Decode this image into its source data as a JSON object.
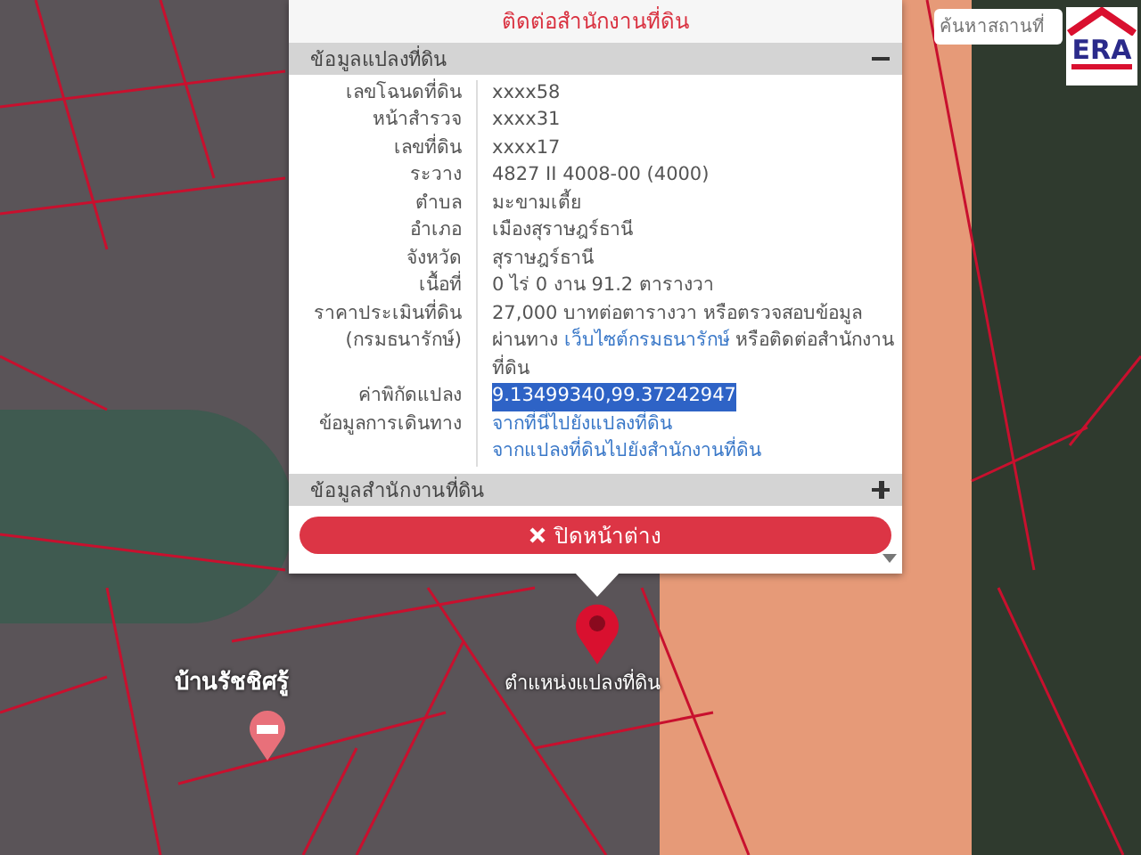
{
  "popup": {
    "contact_link": "ติดต่อสำนักงานที่ดิน",
    "sections": [
      {
        "title": "ข้อมูลแปลงที่ดิน",
        "expanded": true,
        "rows": [
          {
            "kind": "text",
            "label": "เลขโฉนดที่ดิน",
            "value": "xxxx58"
          },
          {
            "kind": "text",
            "label": "หน้าสำรวจ",
            "value": "xxxx31"
          },
          {
            "kind": "text",
            "label": "เลขที่ดิน",
            "value": "xxxx17"
          },
          {
            "kind": "text",
            "label": "ระวาง",
            "value": "4827 II 4008-00 (4000)"
          },
          {
            "kind": "text",
            "label": "ตำบล",
            "value": "มะขามเตี้ย"
          },
          {
            "kind": "text",
            "label": "อำเภอ",
            "value": "เมืองสุราษฎร์ธานี"
          },
          {
            "kind": "text",
            "label": "จังหวัด",
            "value": "สุราษฎร์ธานี"
          },
          {
            "kind": "text",
            "label": "เนื้อที่",
            "value": "0 ไร่ 0 งาน 91.2 ตารางวา"
          },
          {
            "kind": "price",
            "label": "ราคาประเมินที่ดิน (กรมธนารักษ์)",
            "value": "27,000 บาทต่อตารางวา หรือตรวจสอบข้อมูลผ่านทาง",
            "link": "เว็บไซต์กรมธนารักษ์",
            "value_after": "หรือติดต่อสำนักงานที่ดิน"
          },
          {
            "kind": "coords",
            "label": "ค่าพิกัดแปลง",
            "value": "9.13499340,99.37242947",
            "selected": true
          },
          {
            "kind": "links",
            "label": "ข้อมูลการเดินทาง",
            "links": [
              "จากที่นี่ไปยังแปลงที่ดิน",
              "จากแปลงที่ดินไปยังสำนักงานที่ดิน"
            ]
          }
        ]
      },
      {
        "title": "ข้อมูลสำนักงานที่ดิน",
        "expanded": false
      }
    ],
    "close_button": "ปิดหน้าต่าง"
  },
  "map": {
    "search_placeholder": "ค้นหาสถานที่",
    "logo": "ERA",
    "place_label": "บ้านรัชชิศรู้",
    "marker_label": "ตำแหน่งแปลงที่ดิน"
  }
}
